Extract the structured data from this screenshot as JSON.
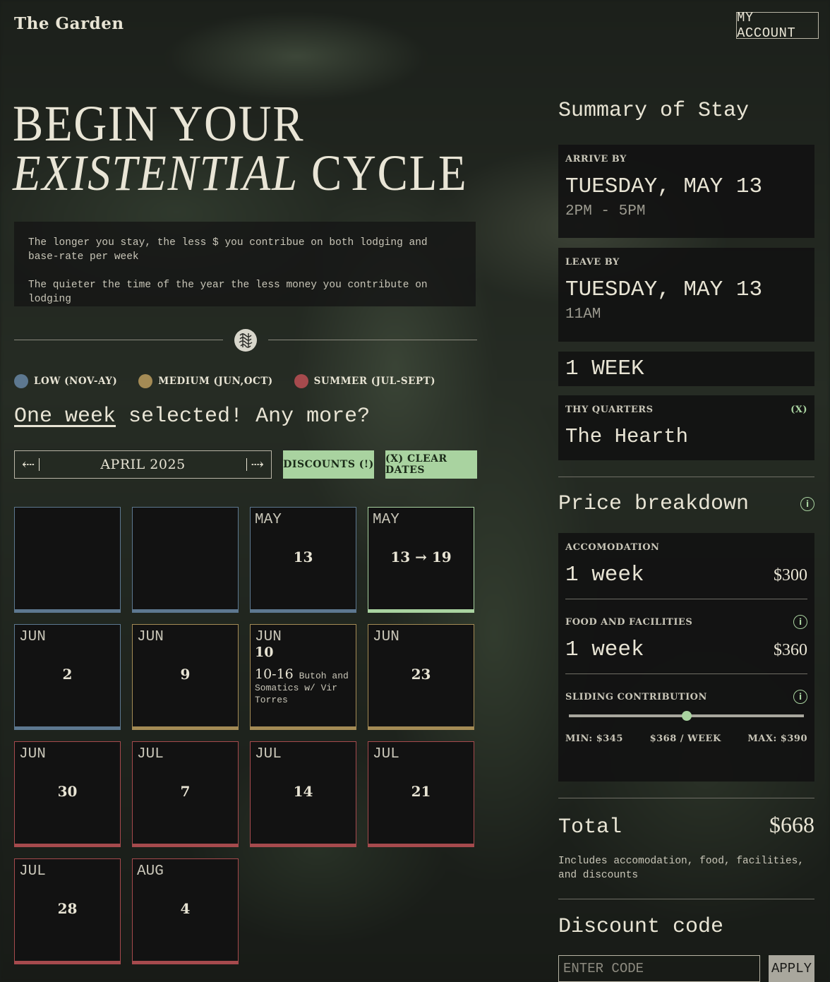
{
  "header": {
    "brand": "The Garden",
    "account_label": "MY ACCOUNT"
  },
  "hero": {
    "line1": "BEGIN YOUR",
    "line2_italic": "EXISTENTIAL",
    "line2_rest": "CYCLE"
  },
  "info": {
    "p1": "The longer you stay, the less $ you contribue on both lodging and base-rate per week",
    "p2": "The quieter the time of the year the less money you contribute on lodging"
  },
  "legend": [
    {
      "label": "LOW (NOV-AY)",
      "color": "#5d7890"
    },
    {
      "label": "MEDIUM (JUN,OCT)",
      "color": "#a48b55"
    },
    {
      "label": "SUMMER (JUL-SEPT)",
      "color": "#a64a4d"
    }
  ],
  "selection": {
    "underlined": "One week",
    "rest": " selected! Any more?"
  },
  "calendar": {
    "month_label": "APRIL 2025",
    "discounts_label": "DISCOUNTS (!)",
    "clear_label": "(X) CLEAR DATES",
    "cells": [
      {
        "season": "low",
        "month": "",
        "day": ""
      },
      {
        "season": "low",
        "month": "",
        "day": ""
      },
      {
        "season": "low",
        "month": "MAY",
        "day": "13"
      },
      {
        "season": "sel",
        "month": "MAY",
        "day": "13 → 19"
      },
      {
        "season": "low",
        "month": "JUN",
        "day": "2"
      },
      {
        "season": "med",
        "month": "JUN",
        "day": "9"
      },
      {
        "season": "med",
        "month": "JUN",
        "day": "10",
        "event_range": "10-16",
        "event_text": " Butoh and Somatics w/ Vir Torres"
      },
      {
        "season": "med",
        "month": "JUN",
        "day": "23"
      },
      {
        "season": "sum",
        "month": "JUN",
        "day": "30"
      },
      {
        "season": "sum",
        "month": "JUL",
        "day": "7"
      },
      {
        "season": "sum",
        "month": "JUL",
        "day": "14"
      },
      {
        "season": "sum",
        "month": "JUL",
        "day": "21"
      },
      {
        "season": "sum",
        "month": "JUL",
        "day": "28"
      },
      {
        "season": "sum",
        "month": "AUG",
        "day": "4"
      }
    ]
  },
  "summary": {
    "title": "Summary of Stay",
    "arrive_label": "ARRIVE BY",
    "arrive_date": "TUESDAY, MAY 13",
    "arrive_time": "2PM - 5PM",
    "leave_label": "LEAVE BY",
    "leave_date": "TUESDAY, MAY 13",
    "leave_time": "11AM",
    "duration": "1 WEEK",
    "quarters_label": "THY QUARTERS",
    "quarters_clear": "(X)",
    "quarters_name": "The Hearth"
  },
  "price": {
    "title": "Price breakdown",
    "accom_label": "ACCOMODATION",
    "accom_duration": "1 week",
    "accom_price": "$300",
    "food_label": "FOOD AND FACILITIES",
    "food_duration": "1 week",
    "food_price": "$360",
    "sliding_label": "SLIDING CONTRIBUTION",
    "slider_value": 0.5,
    "min_label": "MIN: $345",
    "current_label": "$368 / WEEK",
    "max_label": "MAX: $390",
    "total_label": "Total",
    "total_value": "$668",
    "total_note": "Includes accomodation, food, facilities, and discounts"
  },
  "discount": {
    "title": "Discount code",
    "placeholder": "ENTER CODE",
    "apply_label": "APPLY"
  },
  "icons": {
    "prev": "arrow-left-icon",
    "next": "arrow-right-icon",
    "info": "info-icon",
    "emblem": "emblem-icon"
  }
}
